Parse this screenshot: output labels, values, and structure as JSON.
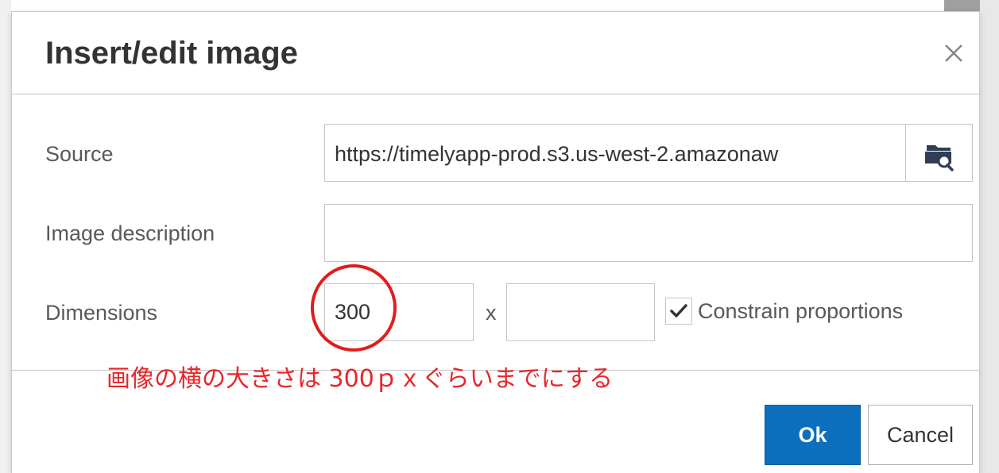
{
  "dialog": {
    "title": "Insert/edit image",
    "close_icon": "close-icon"
  },
  "form": {
    "source": {
      "label": "Source",
      "value": "https://timelyapp-prod.s3.us-west-2.amazonaw",
      "browse_icon": "folder-search-icon"
    },
    "description": {
      "label": "Image description",
      "value": ""
    },
    "dimensions": {
      "label": "Dimensions",
      "width": "300",
      "height": "",
      "separator": "x",
      "constrain_label": "Constrain proportions",
      "constrain_checked": true
    }
  },
  "annotation": {
    "text": "画像の横の大きさは 300ｐｘぐらいまでにする",
    "color": "#e8262a"
  },
  "buttons": {
    "ok": "Ok",
    "cancel": "Cancel"
  },
  "colors": {
    "primary": "#0b6fbd",
    "highlight": "#e01d1f"
  }
}
